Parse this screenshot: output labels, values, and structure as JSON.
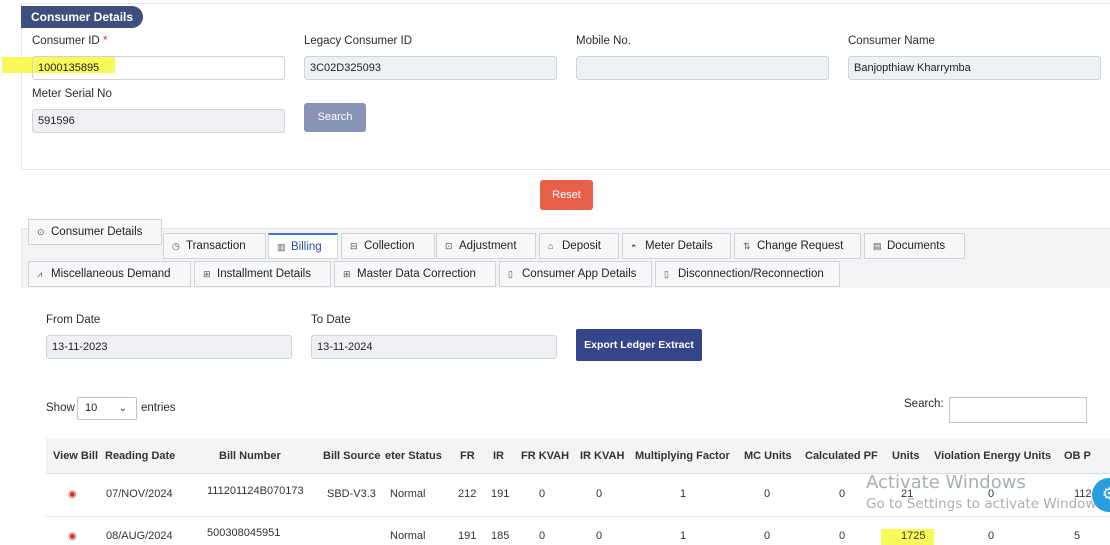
{
  "consumer_section": {
    "title": "Consumer Details",
    "consumer_id_label": "Consumer ID",
    "required_mark": "*",
    "consumer_id_value": "1000135895",
    "legacy_id_label": "Legacy Consumer ID",
    "legacy_id_value": "3C02D325093",
    "mobile_label": "Mobile No.",
    "mobile_value": "",
    "consumer_name_label": "Consumer Name",
    "consumer_name_value": "Banjopthiaw Kharrymba",
    "meter_serial_label": "Meter Serial No",
    "meter_serial_value": "591596",
    "search_label": "Search"
  },
  "reset_label": "Reset",
  "tabs": [
    {
      "label": "Consumer Details",
      "icon": "⊙"
    },
    {
      "label": "Transaction",
      "icon": "◷"
    },
    {
      "label": "Billing",
      "icon": "▥"
    },
    {
      "label": "Collection",
      "icon": "⊟"
    },
    {
      "label": "Adjustment",
      "icon": "⊡"
    },
    {
      "label": "Deposit",
      "icon": "⌂"
    },
    {
      "label": "Meter Details",
      "icon": "◓"
    },
    {
      "label": "Change Request",
      "icon": "⇅"
    },
    {
      "label": "Documents",
      "icon": "▤"
    },
    {
      "label": "Miscellaneous Demand",
      "icon": "⩘"
    },
    {
      "label": "Installment Details",
      "icon": "⊞"
    },
    {
      "label": "Master Data Correction",
      "icon": "⊞"
    },
    {
      "label": "Consumer App Details",
      "icon": "▯"
    },
    {
      "label": "Disconnection/Reconnection",
      "icon": "▯"
    }
  ],
  "billing": {
    "from_date_label": "From Date",
    "from_date_value": "13-11-2023",
    "to_date_label": "To Date",
    "to_date_value": "13-11-2024",
    "export_label": "Export Ledger Extract",
    "show_label": "Show",
    "entries_value": "10",
    "entries_label": "entries",
    "search_label": "Search:",
    "columns": [
      "View Bill",
      "Reading Date",
      "Bill Number",
      "Bill Source",
      "eter Status",
      "FR",
      "IR",
      "FR KVAH",
      "IR KVAH",
      "Multiplying Factor",
      "MC Units",
      "Calculated PF",
      "Units",
      "Violation Energy Units",
      "OB P"
    ],
    "rows": [
      {
        "reading_date": "07/NOV/2024",
        "bill_number": "111201124B070173",
        "bill_source": "SBD-V3.3",
        "meter_status": "Normal",
        "fr": "212",
        "ir": "191",
        "fr_kvah": "0",
        "ir_kvah": "0",
        "mf": "1",
        "mc_units": "0",
        "calc_pf": "0",
        "units": "21",
        "violation": "0",
        "ob": "112"
      },
      {
        "reading_date": "08/AUG/2024",
        "bill_number": "500308045951",
        "bill_source": "",
        "meter_status": "Normal",
        "fr": "191",
        "ir": "185",
        "fr_kvah": "0",
        "ir_kvah": "0",
        "mf": "1",
        "mc_units": "0",
        "calc_pf": "0",
        "units": "1725",
        "violation": "0",
        "ob": "5"
      }
    ]
  },
  "watermark": {
    "line1": "Activate Windows",
    "line2": "Go to Settings to activate Windows."
  },
  "colors": {
    "section_pill": "#3f4f7d",
    "search_button": "#8893b6",
    "reset_button": "#e8604a",
    "export_button": "#34458a",
    "highlight": "#f9f95a",
    "view_icon": "#d62b2b"
  }
}
